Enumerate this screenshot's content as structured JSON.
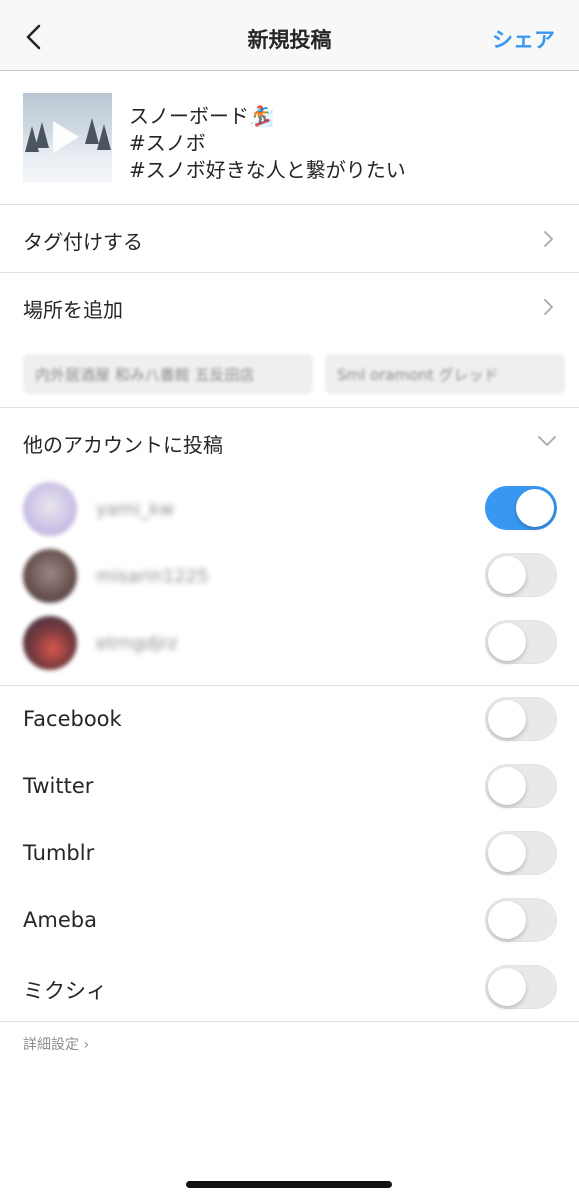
{
  "header": {
    "title": "新規投稿",
    "share_label": "シェア",
    "back_icon": "chevron-left-icon"
  },
  "post": {
    "caption_lines": [
      "スノーボード🏂",
      "#スノボ",
      "#スノボ好きな人と繋がりたい"
    ],
    "thumbnail": "video-thumbnail",
    "play_icon": "play-icon"
  },
  "rows": {
    "tag": "タグ付けする",
    "location": "場所を追加",
    "location_suggestions": [
      "内外居酒屋 和み八番館 五反田店",
      "Sml oramont グレッド"
    ]
  },
  "other_accounts": {
    "label": "他のアカウントに投稿",
    "items": [
      {
        "name": "yami_kw",
        "enabled": true
      },
      {
        "name": "misarin1225",
        "enabled": false
      },
      {
        "name": "etrngdjrz",
        "enabled": false
      }
    ]
  },
  "social": [
    {
      "label": "Facebook",
      "enabled": false
    },
    {
      "label": "Twitter",
      "enabled": false
    },
    {
      "label": "Tumblr",
      "enabled": false
    },
    {
      "label": "Ameba",
      "enabled": false
    },
    {
      "label": "ミクシィ",
      "enabled": false
    }
  ],
  "advanced_settings": "詳細設定 ›",
  "colors": {
    "accent": "#3897f0",
    "text": "#262626",
    "secondary": "#8e8e8e",
    "toggle_off": "#e9e9eb"
  }
}
